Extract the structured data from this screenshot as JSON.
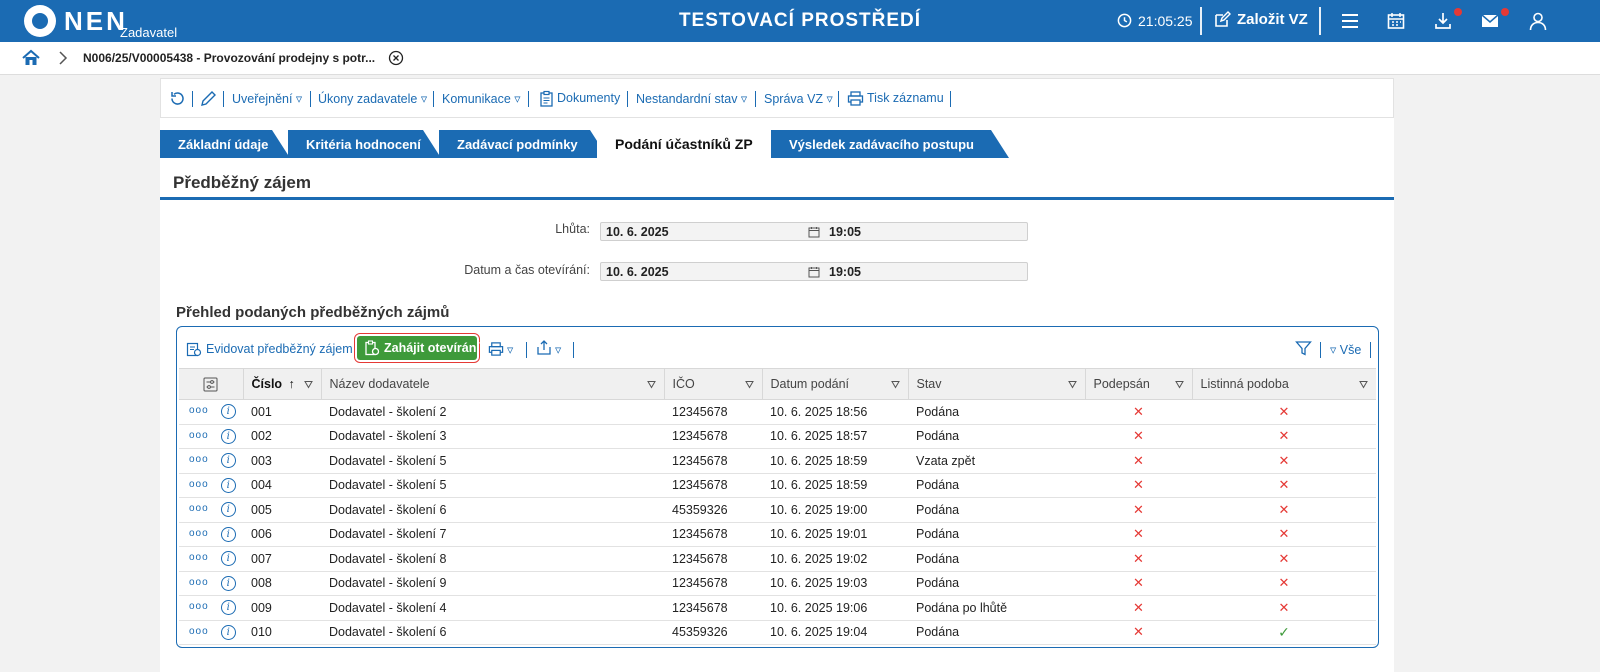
{
  "header": {
    "logo": "NEN",
    "logo_sub": "Zadavatel",
    "env_title": "TESTOVACÍ PROSTŘEDÍ",
    "clock": "21:05:25",
    "create_label": "Založit VZ",
    "accent": "#1b6bb3"
  },
  "breadcrumb": {
    "text": "N006/25/V00005438 - Provozování prodejny s potr..."
  },
  "toolbar": {
    "uverejneni": "Uveřejnění",
    "ukony": "Úkony zadavatele",
    "komunikace": "Komunikace",
    "dokumenty": "Dokumenty",
    "nestandardni": "Nestandardní stav",
    "sprava": "Správa VZ",
    "tisk": "Tisk záznamu"
  },
  "tabs": [
    {
      "label": "Základní údaje"
    },
    {
      "label": "Kritéria hodnocení"
    },
    {
      "label": "Zadávací podmínky"
    },
    {
      "label": "Podání účastníků ZP"
    },
    {
      "label": "Výsledek zadávacího postupu"
    }
  ],
  "section": {
    "title": "Předběžný zájem",
    "lhuta_label": "Lhůta:",
    "lhuta_date": "10. 6. 2025",
    "lhuta_time": "19:05",
    "otevreni_label": "Datum a čas otevírání:",
    "otevreni_date": "10. 6. 2025",
    "otevreni_time": "19:05"
  },
  "overview": {
    "title": "Přehled podaných předběžných zájmů",
    "evidovat": "Evidovat předběžný zájem",
    "zahajit": "Zahájit otevírání",
    "vse": "Vše"
  },
  "table": {
    "columns": [
      "Číslo",
      "Název dodavatele",
      "IČO",
      "Datum podání",
      "Stav",
      "Podepsán",
      "Listinná podoba"
    ],
    "rows": [
      {
        "cislo": "001",
        "nazev": "Dodavatel - školení 2",
        "ico": "12345678",
        "datum": "10. 6. 2025 18:56",
        "stav": "Podána",
        "podepsan": "✕",
        "listinna": "✕"
      },
      {
        "cislo": "002",
        "nazev": "Dodavatel - školení 3",
        "ico": "12345678",
        "datum": "10. 6. 2025 18:57",
        "stav": "Podána",
        "podepsan": "✕",
        "listinna": "✕"
      },
      {
        "cislo": "003",
        "nazev": "Dodavatel - školení 5",
        "ico": "12345678",
        "datum": "10. 6. 2025 18:59",
        "stav": "Vzata zpět",
        "podepsan": "✕",
        "listinna": "✕"
      },
      {
        "cislo": "004",
        "nazev": "Dodavatel - školení 5",
        "ico": "12345678",
        "datum": "10. 6. 2025 18:59",
        "stav": "Podána",
        "podepsan": "✕",
        "listinna": "✕"
      },
      {
        "cislo": "005",
        "nazev": "Dodavatel - školení 6",
        "ico": "45359326",
        "datum": "10. 6. 2025 19:00",
        "stav": "Podána",
        "podepsan": "✕",
        "listinna": "✕"
      },
      {
        "cislo": "006",
        "nazev": "Dodavatel - školení 7",
        "ico": "12345678",
        "datum": "10. 6. 2025 19:01",
        "stav": "Podána",
        "podepsan": "✕",
        "listinna": "✕"
      },
      {
        "cislo": "007",
        "nazev": "Dodavatel - školení 8",
        "ico": "12345678",
        "datum": "10. 6. 2025 19:02",
        "stav": "Podána",
        "podepsan": "✕",
        "listinna": "✕"
      },
      {
        "cislo": "008",
        "nazev": "Dodavatel - školení 9",
        "ico": "12345678",
        "datum": "10. 6. 2025 19:03",
        "stav": "Podána",
        "podepsan": "✕",
        "listinna": "✕"
      },
      {
        "cislo": "009",
        "nazev": "Dodavatel - školení 4",
        "ico": "12345678",
        "datum": "10. 6. 2025 19:06",
        "stav": "Podána po lhůtě",
        "podepsan": "✕",
        "listinna": "✕"
      },
      {
        "cislo": "010",
        "nazev": "Dodavatel - školení 6",
        "ico": "45359326",
        "datum": "10. 6. 2025 19:04",
        "stav": "Podána",
        "podepsan": "✕",
        "listinna": "✓"
      }
    ]
  }
}
